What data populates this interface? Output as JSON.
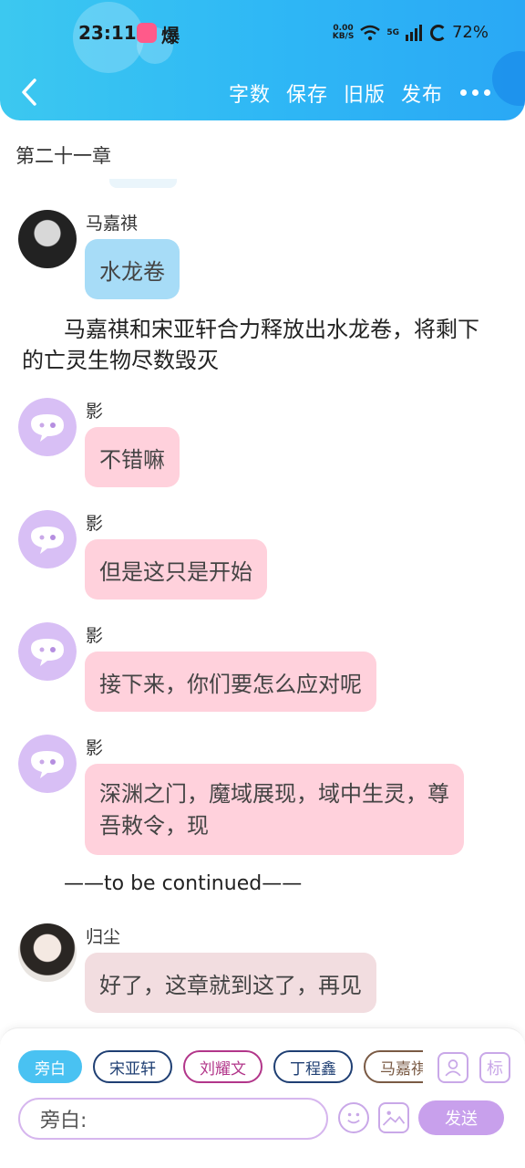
{
  "status_bar": {
    "time": "23:11",
    "app_badge": "爆",
    "net_speed_value": "0.00",
    "net_speed_unit": "KB/S",
    "network": "5G",
    "battery": "72%"
  },
  "header": {
    "tools": [
      "字数",
      "保存",
      "旧版",
      "发布"
    ],
    "accent_color": "#2fb8f5"
  },
  "chapter": {
    "title": "第二十一章"
  },
  "messages": [
    {
      "name": "马嘉祺",
      "text": "水龙卷",
      "color": "blue",
      "avatar": "photo-avatar"
    },
    {
      "name": "影",
      "text": "不错嘛",
      "color": "pink",
      "avatar": "chat-bubble-avatar"
    },
    {
      "name": "影",
      "text": "但是这只是开始",
      "color": "pink",
      "avatar": "chat-bubble-avatar"
    },
    {
      "name": "影",
      "text": "接下来，你们要怎么应对呢",
      "color": "pink",
      "avatar": "chat-bubble-avatar"
    },
    {
      "name": "影",
      "text": "深渊之门，魔域展现，域中生灵，尊吾敕令，现",
      "color": "pink",
      "avatar": "chat-bubble-avatar"
    },
    {
      "name": "归尘",
      "text": "好了，这章就到这了，再见",
      "color": "grey",
      "avatar": "photo-avatar"
    }
  ],
  "narration": "马嘉祺和宋亚轩合力释放出水龙卷，将剩下的亡灵生物尽数毁灭",
  "tbc": "——to be continued——",
  "composer": {
    "roles": [
      "旁白",
      "宋亚轩",
      "刘耀文",
      "丁程鑫",
      "马嘉祺"
    ],
    "mark_icon_label": "标",
    "input_value": "旁白:",
    "send_label": "发送"
  }
}
